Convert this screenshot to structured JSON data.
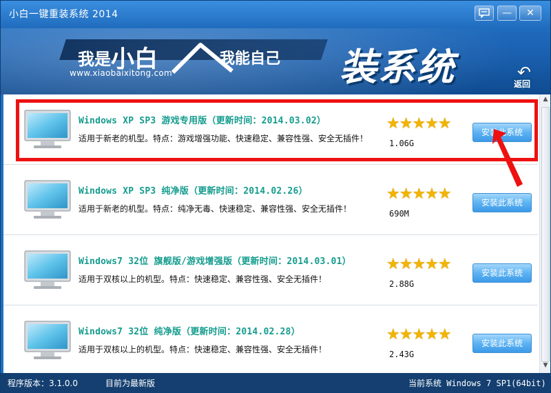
{
  "window": {
    "title": "小白一键重装系统 2014",
    "controls": {
      "feedback_icon": "chat-icon",
      "minimize": "—",
      "close": "✕"
    }
  },
  "banner": {
    "slogan_part1_small": "我是",
    "slogan_part1_big": "小白",
    "slogan_part2": "我能自己",
    "url": "www.xiaobaixitong.com",
    "big_title": "装系统",
    "back_label": "返回"
  },
  "systems": [
    {
      "title": "Windows XP SP3 游戏专用版（更新时间：2014.03.02）",
      "description": "适用于新老的机型。特点：游戏增强功能、快速稳定、兼容性强、安全无插件！",
      "rating": 5,
      "stars": "★★★★★",
      "size": "1.06G",
      "button": "安装此系统"
    },
    {
      "title": "Windows XP SP3 纯净版（更新时间：2014.02.26）",
      "description": "适用于新老的机型。特点：纯净无毒、快速稳定、兼容性强、安全无插件！",
      "rating": 5,
      "stars": "★★★★★",
      "size": "690M",
      "button": "安装此系统"
    },
    {
      "title": "Windows7 32位 旗舰版/游戏增强版（更新时间：2014.03.01）",
      "description": "适用于双核以上的机型。特点：快速稳定、兼容性强、安全无插件！",
      "rating": 5,
      "stars": "★★★★★",
      "size": "2.88G",
      "button": "安装此系统"
    },
    {
      "title": "Windows7 32位 纯净版（更新时间：2014.02.28）",
      "description": "适用于双核以上的机型。特点：快速稳定、兼容性强、安全无插件！",
      "rating": 5,
      "stars": "★★★★★",
      "size": "2.43G",
      "button": "安装此系统"
    }
  ],
  "statusbar": {
    "version": "程序版本：3.1.0.0",
    "update_status": "目前为最新版",
    "current_system": "当前系统 Windows 7 SP1(64bit)"
  },
  "colors": {
    "title_text": "#149c8e",
    "header_blue": "#1f6bbd",
    "statusbar_bg": "#143f70",
    "highlight_red": "#ee1111",
    "star_gold": "#f2b400",
    "install_button": "#5db3f2"
  }
}
